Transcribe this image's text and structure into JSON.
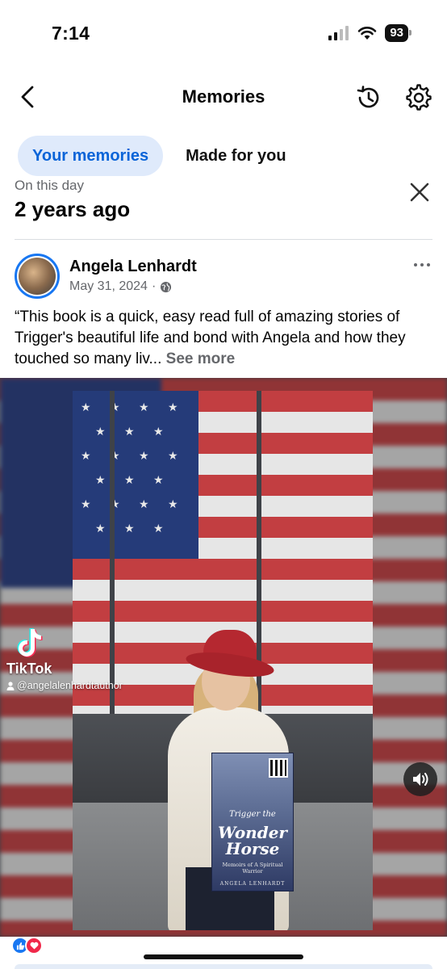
{
  "status_bar": {
    "time": "7:14",
    "battery": "93"
  },
  "header": {
    "title": "Memories",
    "back_icon": "chevron-left-icon",
    "history_icon": "history-icon",
    "settings_icon": "gear-icon"
  },
  "tabs": [
    {
      "label": "Your memories",
      "active": true
    },
    {
      "label": "Made for you",
      "active": false
    }
  ],
  "memory": {
    "section_label": "On this day",
    "time_ago": "2 years ago"
  },
  "post": {
    "author": "Angela Lenhardt",
    "date": "May 31, 2024",
    "separator": "·",
    "audience": "globe-icon",
    "text": "“This book is a quick, easy read full of amazing stories of Trigger's beautiful life and bond with Angela and how they touched so many liv...",
    "see_more": "See more"
  },
  "media": {
    "tiktok_label": "TikTok",
    "tiktok_handle": "@angelalenhardtauthor",
    "book": {
      "pre_title": "Trigger the",
      "title_line1": "Wonder",
      "title_line2": "Horse",
      "subtitle": "Memoirs of A Spiritual Warrior",
      "author": "ANGELA LENHARDT"
    }
  },
  "colors": {
    "accent": "#1877f2",
    "tab_active_bg": "#dfeafb",
    "tab_active_text": "#0a64d8",
    "secondary_text": "#65676b"
  }
}
